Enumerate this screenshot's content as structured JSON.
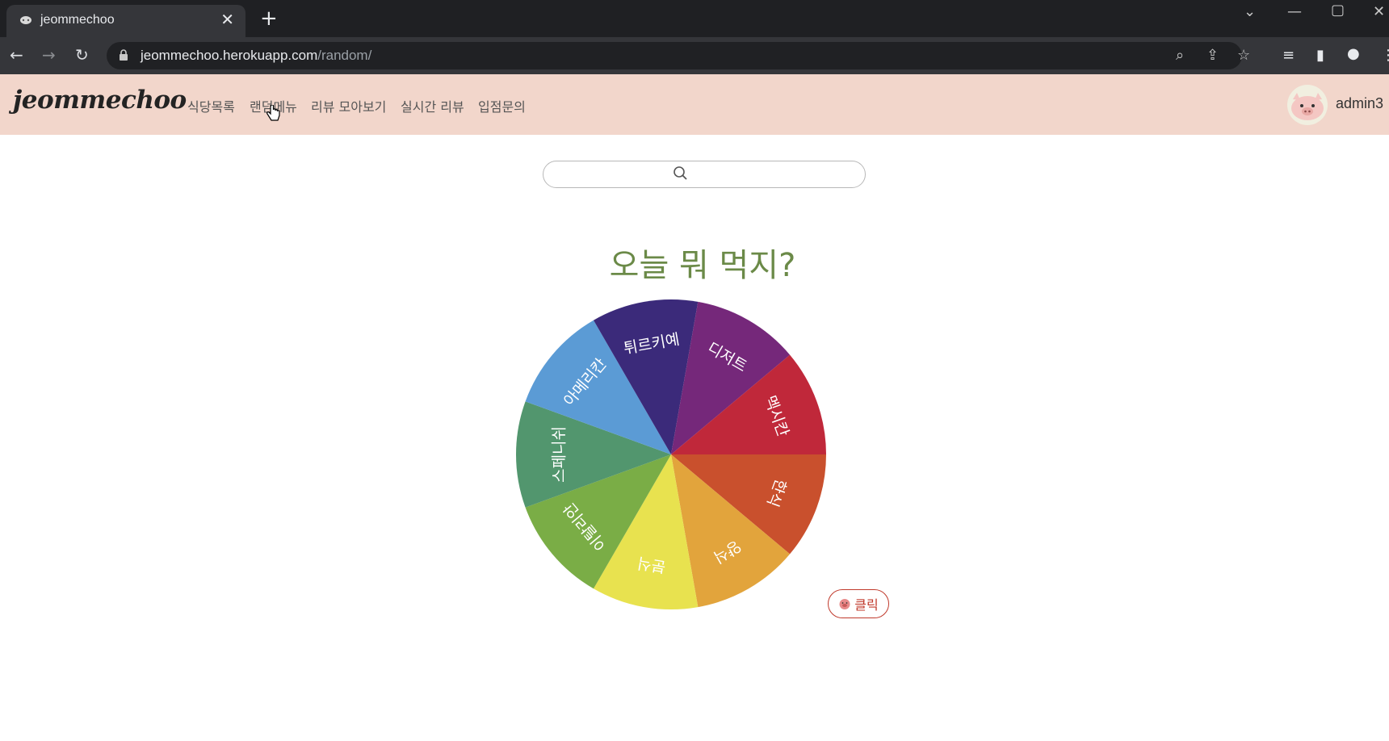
{
  "browser": {
    "tab_title": "jeommechoo",
    "url_host": "jeommechoo.herokuapp.com",
    "url_path": "/random/"
  },
  "header": {
    "logo": "jeommechoo",
    "nav": [
      "식당목록",
      "랜덤메뉴",
      "리뷰 모아보기",
      "실시간 리뷰",
      "입점문의"
    ],
    "username": "admin3"
  },
  "main": {
    "title": "오늘 뭐 먹지?",
    "click_label": "클릭"
  },
  "wheel": {
    "segments": [
      {
        "label": "한식",
        "color": "#c9502d"
      },
      {
        "label": "양식",
        "color": "#e2a43c"
      },
      {
        "label": "분식",
        "color": "#e8e24f"
      },
      {
        "label": "이탈리안",
        "color": "#7aad46"
      },
      {
        "label": "스페니쉬",
        "color": "#52966e"
      },
      {
        "label": "아메리칸",
        "color": "#5b9bd5"
      },
      {
        "label": "튀르키예",
        "color": "#3b2a7a"
      },
      {
        "label": "디저트",
        "color": "#75287a"
      },
      {
        "label": "멕시칸",
        "color": "#c0283a"
      }
    ]
  },
  "colors": {
    "header_bg": "#f2d6cb",
    "title": "#6b8a48",
    "accent": "#c0392b"
  }
}
